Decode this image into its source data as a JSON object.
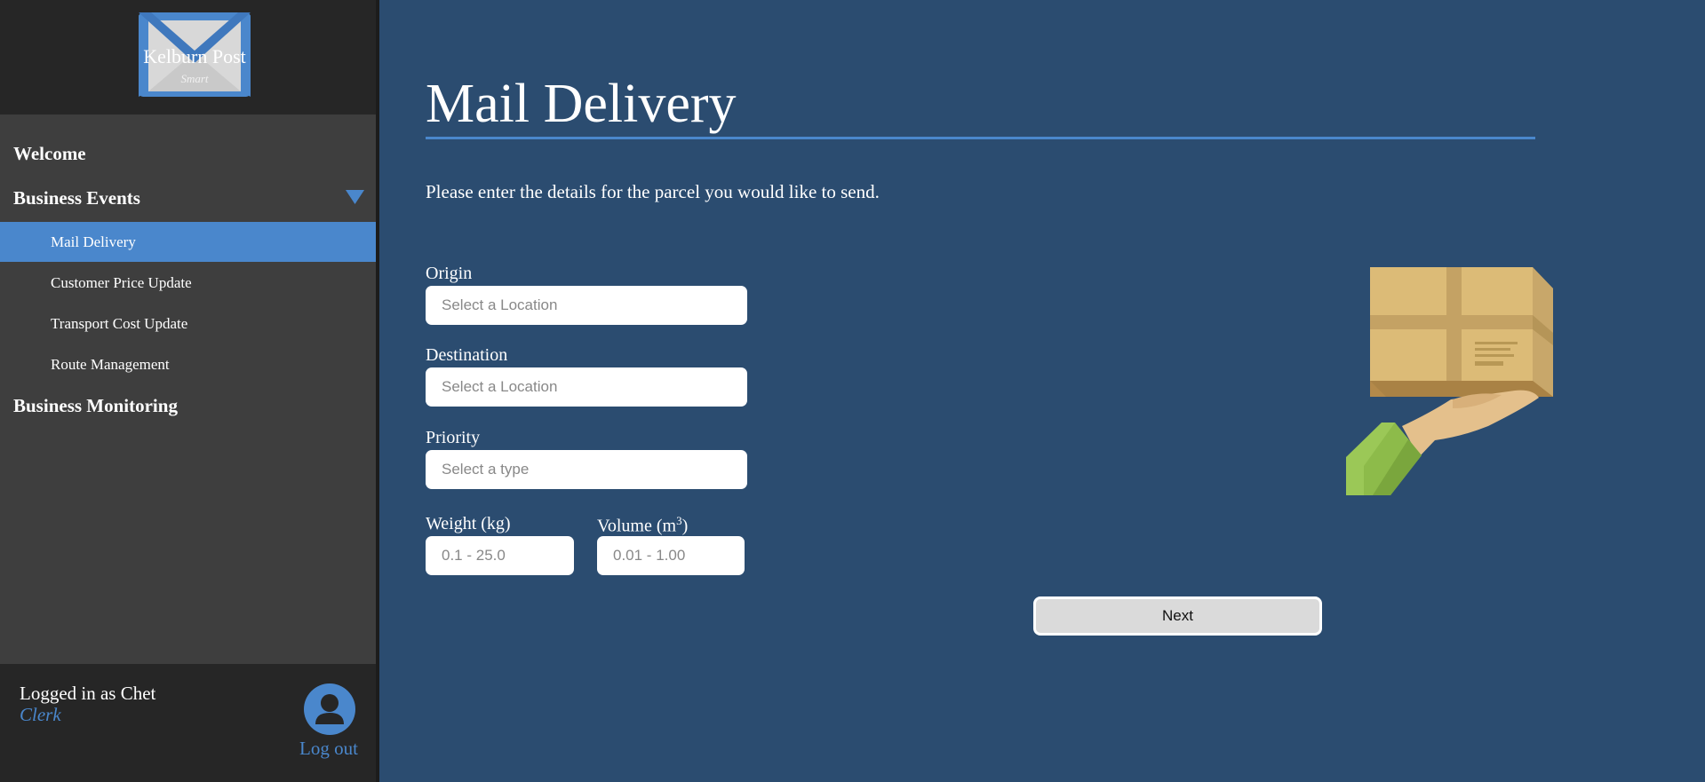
{
  "brand": {
    "name": "Kelburn Post",
    "tagline": "Smart"
  },
  "nav": {
    "welcome": "Welcome",
    "business_events": "Business Events",
    "items": [
      {
        "label": "Mail Delivery",
        "active": true
      },
      {
        "label": "Customer Price Update",
        "active": false
      },
      {
        "label": "Transport Cost Update",
        "active": false
      },
      {
        "label": "Route Management",
        "active": false
      }
    ],
    "business_monitoring": "Business Monitoring"
  },
  "user": {
    "logged_in_text": "Logged in as Chet",
    "role": "Clerk",
    "logout": "Log out"
  },
  "page": {
    "title": "Mail Delivery",
    "intro": "Please enter the details for the parcel you would like to send."
  },
  "form": {
    "origin": {
      "label": "Origin",
      "placeholder": "Select a Location"
    },
    "destination": {
      "label": "Destination",
      "placeholder": "Select a Location"
    },
    "priority": {
      "label": "Priority",
      "placeholder": "Select a type"
    },
    "weight": {
      "label": "Weight (kg)",
      "placeholder": "0.1 - 25.0"
    },
    "volume": {
      "label_prefix": "Volume (m",
      "label_sup": "3",
      "label_suffix": ")",
      "placeholder": "0.01 - 1.00"
    },
    "next": "Next"
  },
  "colors": {
    "accent": "#4a87cc",
    "background": "#2b4c70",
    "sidebar": "#3e3e3e"
  },
  "icons": {
    "logo": "envelope-logo-icon",
    "dropdown": "triangle-down-icon",
    "avatar": "user-avatar-icon",
    "illustration": "hand-holding-parcel-icon"
  }
}
